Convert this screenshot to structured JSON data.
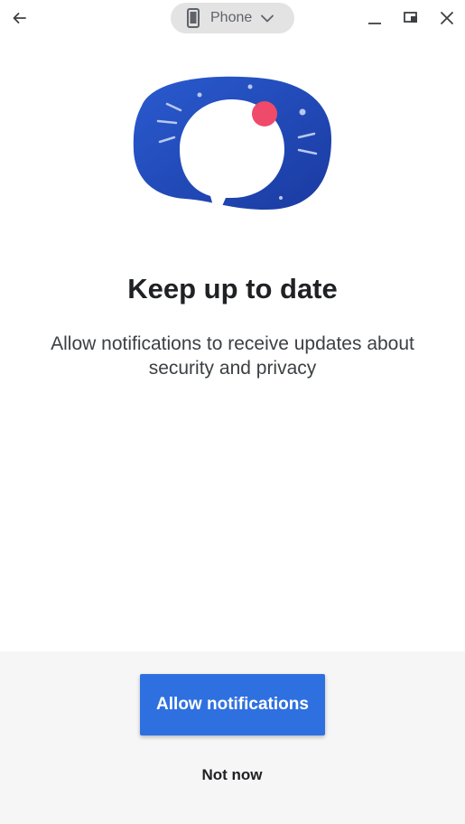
{
  "window": {
    "device_selector": {
      "label": "Phone",
      "icon": "phone-icon",
      "dropdown_icon": "chevron-down-icon"
    },
    "controls": {
      "back_icon": "back-arrow-icon",
      "minimize_icon": "minimize-icon",
      "resize_icon": "resize-icon",
      "close_icon": "close-icon"
    }
  },
  "hero": {
    "illustration": "chat-bubble-notification-illustration",
    "colors": {
      "blob": "#1f4cb8",
      "bubble": "#ffffff",
      "badge": "#ef4a6a",
      "line_gradient_start": "#ef4a6a",
      "line_gradient_end": "#f48a2a"
    }
  },
  "content": {
    "title": "Keep up to date",
    "description": "Allow notifications to receive updates about security and privacy"
  },
  "actions": {
    "primary_label": "Allow notifications",
    "secondary_label": "Not now",
    "accent_color": "#2f70e0"
  }
}
